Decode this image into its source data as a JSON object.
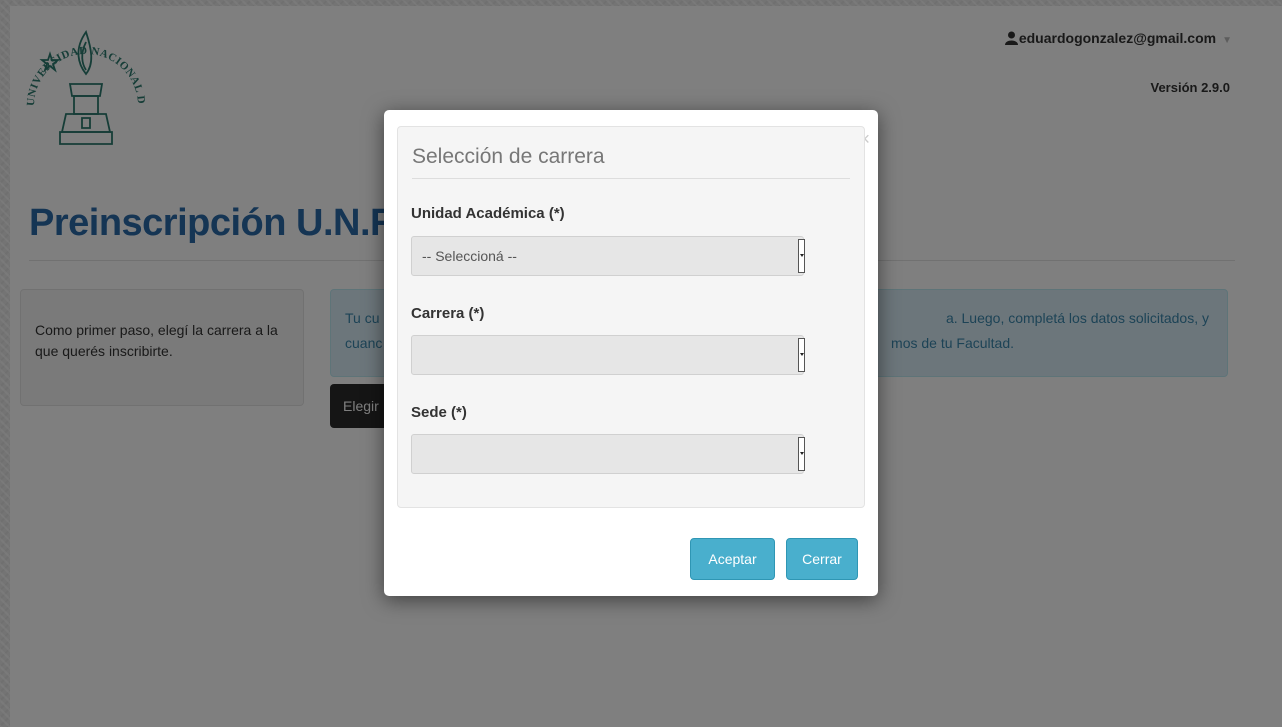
{
  "header": {
    "user_email": "eduardogonzalez@gmail.com",
    "version": "Versión 2.9.0",
    "logo_text": "UNIVERSIDAD NACIONAL DE ROSARIO"
  },
  "page": {
    "title": "Preinscripción U.N.R",
    "side_text": "Como primer paso, elegí la carrera a la que querés inscribirte.",
    "info_line1_left": "Tu cu",
    "info_line1_right": "a. Luego, completá los datos solicitados, y",
    "info_line2_left": "cuanc",
    "info_line2_right": "mos de tu Facultad.",
    "elegir_button": "Elegir"
  },
  "modal": {
    "title": "Selección de carrera",
    "close_glyph": "×",
    "unidad_label": "Unidad Académica (*)",
    "unidad_value": "-- Seleccioná --",
    "carrera_label": "Carrera (*)",
    "carrera_value": "",
    "sede_label": "Sede (*)",
    "sede_value": "",
    "accept_button": "Aceptar",
    "close_button": "Cerrar"
  },
  "colors": {
    "title_blue": "#2a6aa8",
    "info_bg": "#d9edf7",
    "info_text": "#3a87ad",
    "button_info": "#49afcd",
    "logo_green": "#2c7a6f"
  },
  "icons": [
    "user-icon",
    "caret-down-icon",
    "close-icon",
    "dropdown-arrow-icon"
  ]
}
